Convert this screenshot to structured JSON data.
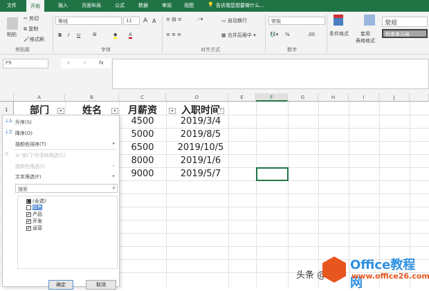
{
  "tabs": [
    "文件",
    "开始",
    "插入",
    "页面布局",
    "公式",
    "数据",
    "审阅",
    "视图"
  ],
  "tell_me": "告诉我您想要做什么...",
  "ribbon": {
    "clipboard": {
      "paste": "粘贴",
      "cut": "剪切",
      "copy": "复制",
      "format_painter": "格式刷",
      "group": "剪贴板"
    },
    "font": {
      "name": "等线",
      "size": "11",
      "grow": "A",
      "shrink": "A",
      "bold": "B",
      "italic": "I",
      "underline": "U",
      "group": "字体"
    },
    "alignment": {
      "wrap": "自动换行",
      "merge": "合并后居中",
      "group": "对齐方式"
    },
    "number": {
      "format": "常规",
      "percent": "%",
      "group": "数字"
    },
    "styles": {
      "conditional": "条件格式",
      "table": "套用\n表格格式",
      "normal": "常规",
      "check_cell": "检查单元格"
    }
  },
  "formula_bar": {
    "name_box": "F9",
    "cancel": "×",
    "enter": "✓",
    "fx": "fx",
    "value": ""
  },
  "columns": [
    "A",
    "B",
    "C",
    "D",
    "E",
    "F",
    "G",
    "H",
    "I",
    "J"
  ],
  "row_number": "1",
  "headers": [
    "部门",
    "姓名",
    "月薪资",
    "入职时间"
  ],
  "salaries": [
    "4500",
    "5000",
    "6500",
    "8000",
    "9000"
  ],
  "dates": [
    "2019/3/4",
    "2019/8/5",
    "2019/10/5",
    "2019/1/6",
    "2019/5/7"
  ],
  "filter_menu": {
    "sort_asc": "升序(S)",
    "sort_desc": "降序(O)",
    "sort_color": "按颜色排序(T)",
    "clear_filter": "从\"部门\"中清除筛选(C)",
    "filter_color": "按颜色筛选(I)",
    "text_filter": "文本筛选(F)",
    "search_placeholder": "搜索",
    "items": [
      {
        "label": "(全选)",
        "state": "■"
      },
      {
        "label": "销售",
        "state": ""
      },
      {
        "label": "产品",
        "state": "✔"
      },
      {
        "label": "开发",
        "state": "✔"
      },
      {
        "label": "运营",
        "state": "✔"
      }
    ],
    "ok": "确定",
    "cancel": "取消"
  },
  "watermark": {
    "prefix": "头条 @",
    "brand": "Office教程网",
    "url": "www.office26.com"
  }
}
